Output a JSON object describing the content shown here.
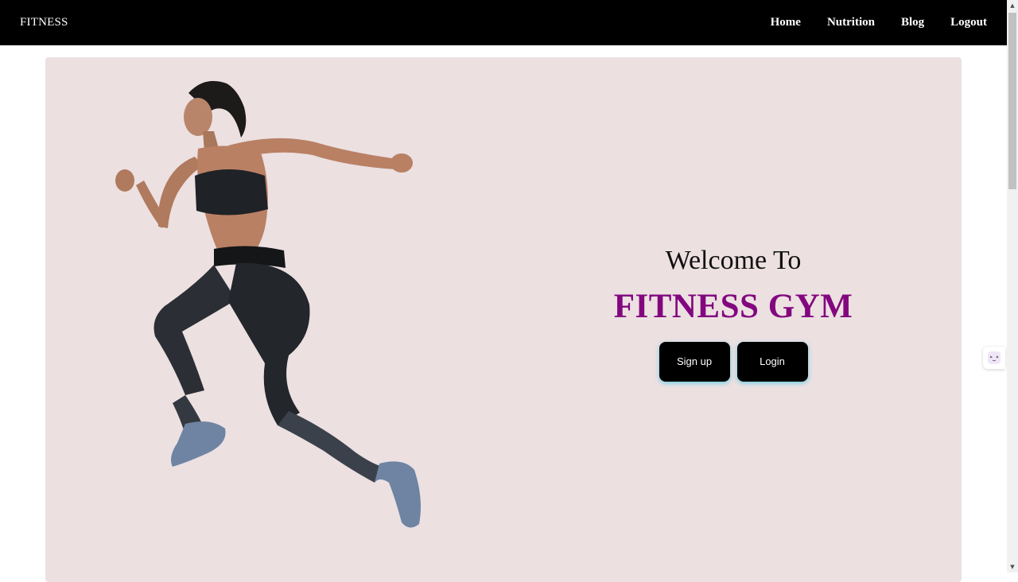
{
  "navbar": {
    "brand": "FITNESS",
    "links": [
      {
        "label": "Home"
      },
      {
        "label": "Nutrition"
      },
      {
        "label": "Blog"
      },
      {
        "label": "Logout"
      }
    ]
  },
  "hero": {
    "welcome": "Welcome To",
    "title": "FITNESS GYM",
    "buttons": {
      "signup": "Sign up",
      "login": "Login"
    }
  },
  "colors": {
    "navbar_bg": "#000000",
    "hero_bg": "#ece0e1",
    "title_color": "#82077f",
    "button_glow": "#46c8e6"
  },
  "icons": {
    "athlete": "running-woman-image",
    "side_widget": "assistant-widget-icon"
  }
}
